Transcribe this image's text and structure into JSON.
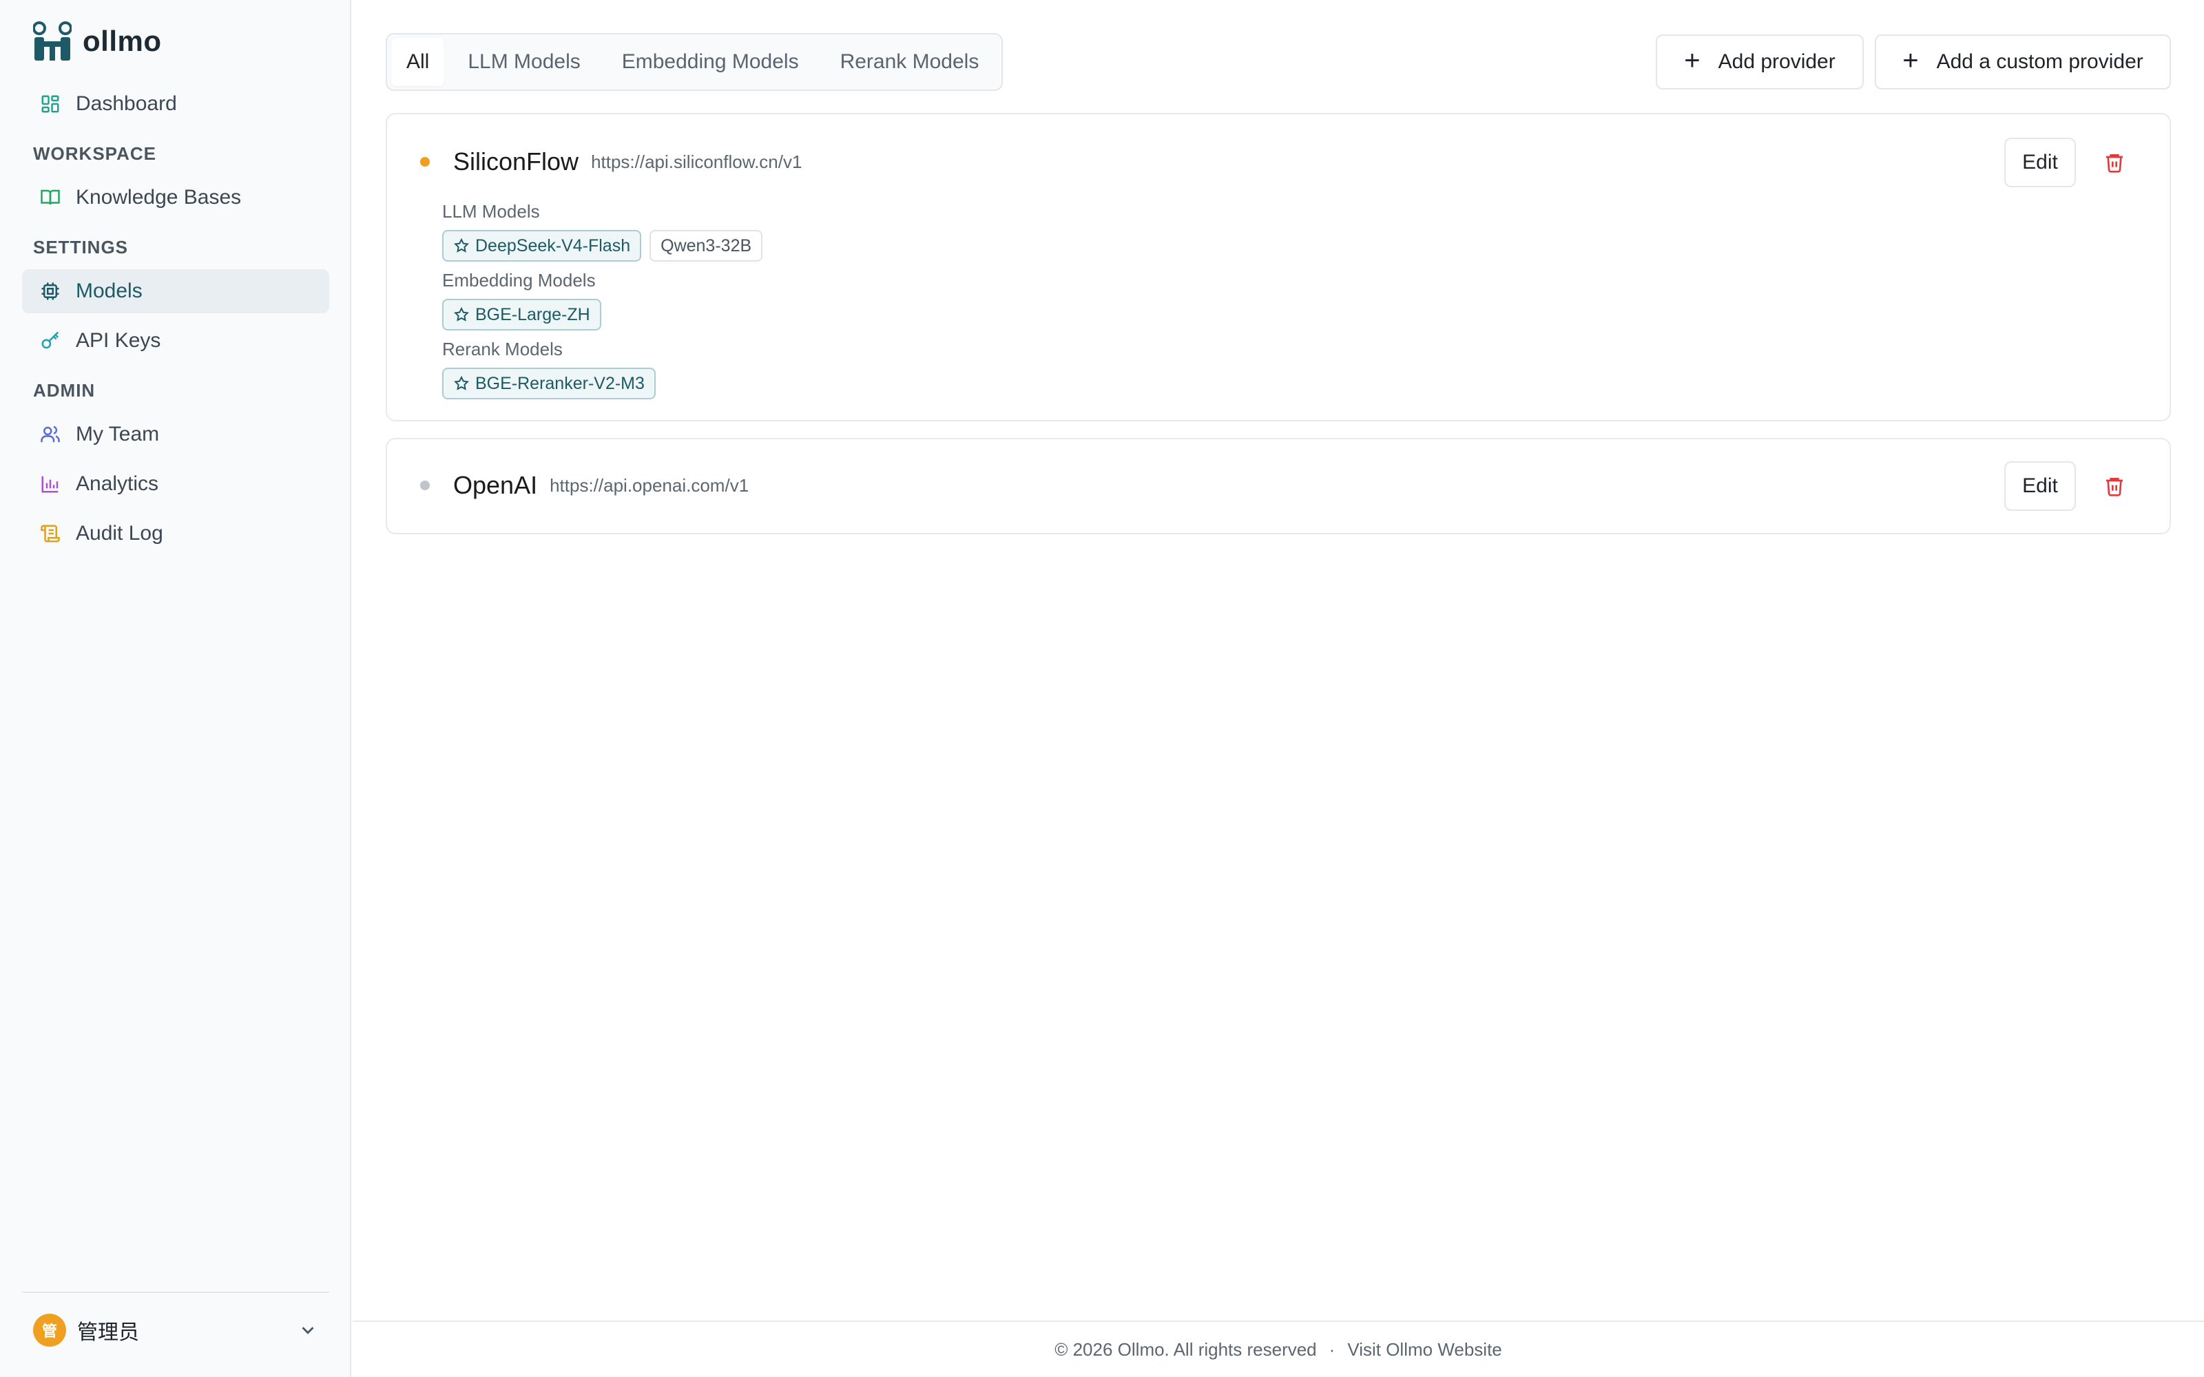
{
  "app": {
    "name": "ollmo"
  },
  "sidebar": {
    "dashboard": "Dashboard",
    "sections": {
      "workspace": "WORKSPACE",
      "settings": "SETTINGS",
      "admin": "ADMIN"
    },
    "items": {
      "knowledge_bases": "Knowledge Bases",
      "models": "Models",
      "api_keys": "API Keys",
      "my_team": "My Team",
      "analytics": "Analytics",
      "audit_log": "Audit Log"
    },
    "active_item": "Models",
    "user": {
      "avatar_char": "管",
      "name": "管理员"
    }
  },
  "tabs": [
    {
      "label": "All",
      "active": true
    },
    {
      "label": "LLM Models",
      "active": false
    },
    {
      "label": "Embedding Models",
      "active": false
    },
    {
      "label": "Rerank Models",
      "active": false
    }
  ],
  "toolbar": {
    "add_provider": "Add provider",
    "add_custom_provider": "Add a custom provider"
  },
  "providers": [
    {
      "name": "SiliconFlow",
      "url": "https://api.siliconflow.cn/v1",
      "status_color": "#f0a020",
      "edit_label": "Edit",
      "groups": [
        {
          "label": "LLM Models",
          "models": [
            {
              "name": "DeepSeek-V4-Flash",
              "default": true
            },
            {
              "name": "Qwen3-32B",
              "default": false
            }
          ]
        },
        {
          "label": "Embedding Models",
          "models": [
            {
              "name": "BGE-Large-ZH",
              "default": true
            }
          ]
        },
        {
          "label": "Rerank Models",
          "models": [
            {
              "name": "BGE-Reranker-V2-M3",
              "default": true
            }
          ]
        }
      ]
    },
    {
      "name": "OpenAI",
      "url": "https://api.openai.com/v1",
      "status_color": "#c0c5cc",
      "edit_label": "Edit",
      "groups": []
    }
  ],
  "footer": {
    "copyright": "© 2026 Ollmo. All rights reserved",
    "separator": "·",
    "website_link": "Visit Ollmo Website"
  },
  "colors": {
    "brand": "#1d5a66",
    "danger": "#e03a3a",
    "warning_dot": "#f0a020"
  }
}
